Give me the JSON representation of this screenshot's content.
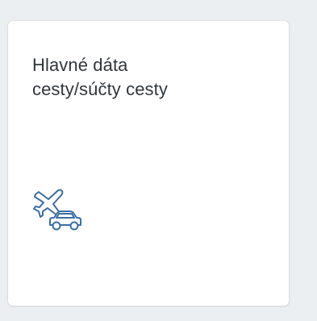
{
  "tile": {
    "title_line1": "Hlavné dáta",
    "title_line2": "cesty/súčty cesty",
    "icon": "travel-plane-car-icon",
    "icon_color": "#3a6ea5",
    "background": "#ffffff"
  },
  "page": {
    "background": "#eceff2"
  }
}
